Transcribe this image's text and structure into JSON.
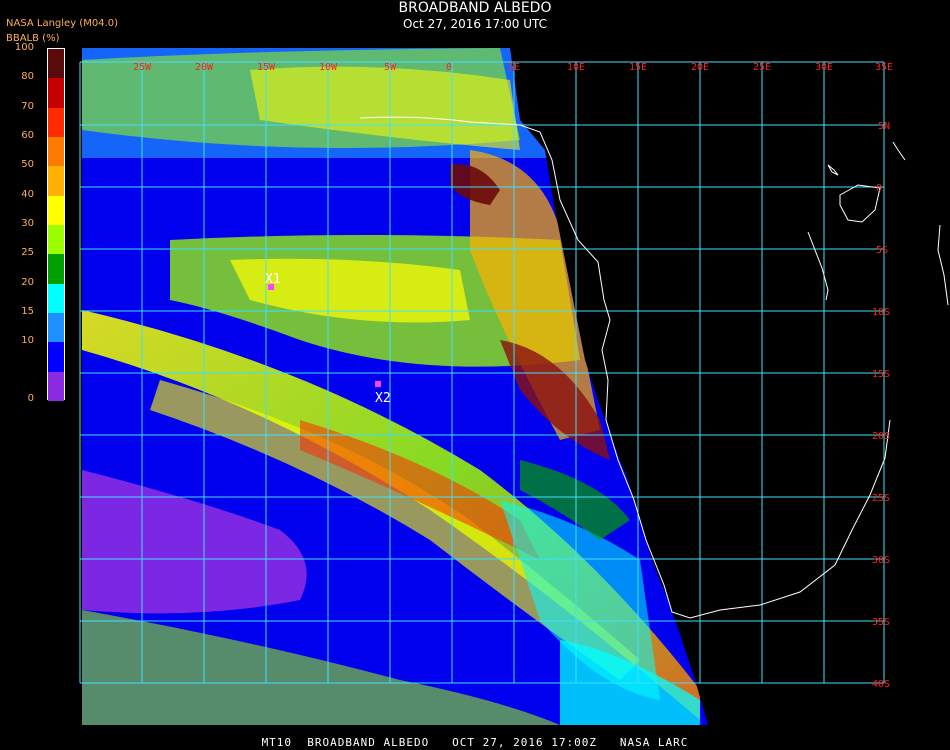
{
  "title": "BROADBAND ALBEDO",
  "subtitle": "Oct 27, 2016 17:00 UTC",
  "organization": "NASA Langley (M04.0)",
  "variable": "BBALB (%)",
  "colorbar": {
    "ticks": [
      "100",
      "80",
      "70",
      "60",
      "50",
      "40",
      "30",
      "25",
      "20",
      "15",
      "10",
      "0"
    ],
    "colors": [
      "#5a0a0a",
      "#c40000",
      "#ff2a00",
      "#ff7a00",
      "#ffb000",
      "#ffff00",
      "#9cff00",
      "#00a000",
      "#00ffff",
      "#1e90ff",
      "#0000ff",
      "#8a2be2"
    ]
  },
  "lon_labels": [
    "25W",
    "20W",
    "15W",
    "10W",
    "5W",
    "0",
    "5E",
    "10E",
    "15E",
    "20E",
    "25E",
    "30E",
    "35E"
  ],
  "lat_labels": [
    "5N",
    "0",
    "5S",
    "10S",
    "15S",
    "20S",
    "25S",
    "30S",
    "35S",
    "40S"
  ],
  "markers": [
    {
      "label": "X1",
      "color": "#ff40ff"
    },
    {
      "label": "X2",
      "color": "#ff40ff"
    }
  ],
  "colors": {
    "grid": "#40e0ff",
    "coast": "#ffffff",
    "latlon_labels": "#ff2020"
  },
  "footer": "MT10  BROADBAND ALBEDO   OCT 27, 2016 17:00Z   NASA LARC"
}
